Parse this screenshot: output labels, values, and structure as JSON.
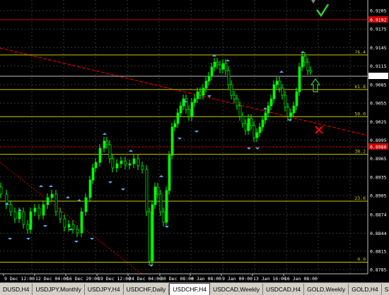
{
  "chart": {
    "symbol": "USDCHF",
    "timeframe": "H4",
    "price_labels": [
      "0.9205",
      "0.9175",
      "0.9145",
      "0.9115",
      "0.9085",
      "0.9055",
      "0.9025",
      "0.8995",
      "0.8965",
      "0.8935",
      "0.8905",
      "0.8874",
      "0.8844",
      "0.8815",
      "0.8785"
    ],
    "price_values": [
      0.9205,
      0.9175,
      0.9145,
      0.9115,
      0.9085,
      0.9055,
      0.9025,
      0.8995,
      0.8965,
      0.8935,
      0.8905,
      0.8874,
      0.8844,
      0.8815,
      0.8785
    ],
    "highlight_labels": {
      "top_red": "0.9192",
      "current": "0.9098",
      "mid_red": "0.8980"
    },
    "time_labels": [
      "9 Dec 12:00",
      "12 Dec 04:00",
      "16 Dec 20:00",
      "19 Dec 12:00",
      "24 Dec 04:00",
      "30 Dec 08:00",
      "6 Jan 08:00",
      "9 Jan 00:00",
      "13 Jan 16:00",
      "16 Jan 08:00"
    ],
    "fib_levels": [
      {
        "label": "76.4",
        "price": 0.9133
      },
      {
        "label": "61.8",
        "price": 0.9077
      },
      {
        "label": "50.0",
        "price": 0.9033
      },
      {
        "label": "38.2",
        "price": 0.8972
      },
      {
        "label": "23.6",
        "price": 0.8896
      },
      {
        "label": "0.0",
        "price": 0.8797
      }
    ],
    "colors": {
      "candle": "#00ff00",
      "fractal": "#55aaee",
      "fib_line": "#c8c800",
      "red_line": "#cc0000",
      "check": "#33cc33",
      "cross": "#ff0000",
      "arrow": "#33cc33"
    },
    "icons": {
      "checkmark": "check-icon",
      "cross": "cross-icon",
      "arrow_up": "arrow-up-icon"
    }
  },
  "tabs": [
    {
      "label": "DUSD,H4",
      "active": false
    },
    {
      "label": "USDJPY,Monthly",
      "active": false
    },
    {
      "label": "USDJPY,H4",
      "active": false
    },
    {
      "label": "USDCHF,Daily",
      "active": false
    },
    {
      "label": "USDCHF,H4",
      "active": true
    },
    {
      "label": "USDCAD,Weekly",
      "active": false
    },
    {
      "label": "USDCAD,H4",
      "active": false
    },
    {
      "label": "GOLD,Weekly",
      "active": false
    },
    {
      "label": "GOLD,H4",
      "active": false
    },
    {
      "label": "SIL",
      "active": false
    }
  ]
}
